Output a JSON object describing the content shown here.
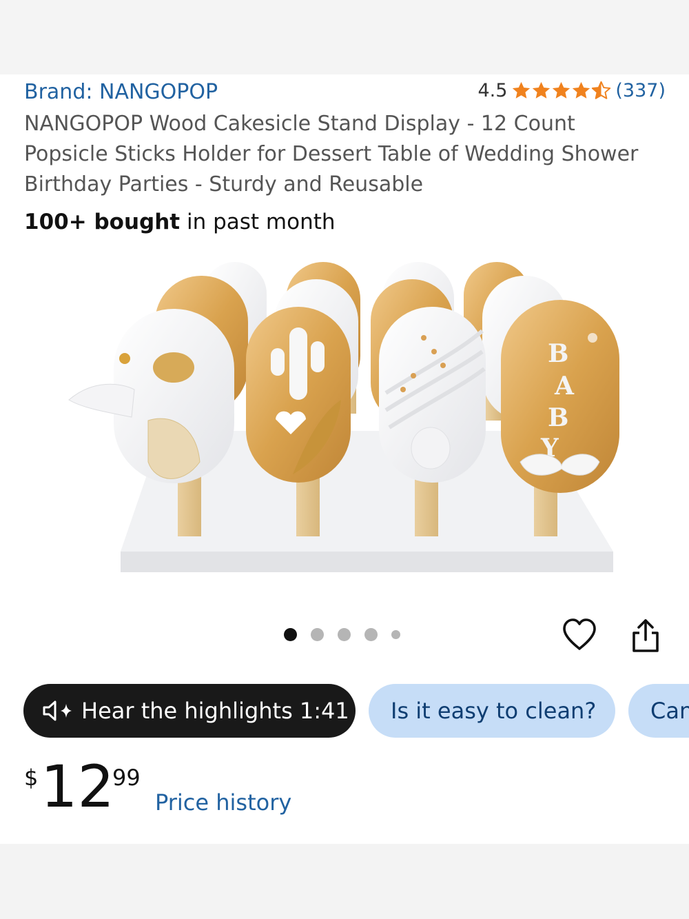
{
  "product": {
    "brand": "Brand: NANGOPOP",
    "rating_value": "4.5",
    "rating": 4.5,
    "rating_count": "(337)",
    "title": "NANGOPOP Wood Cakesicle Stand Display - 12 Count Popsicle Sticks Holder for Dessert Table of Wedding Shower Birthday Parties - Sturdy and Reusable",
    "bought_bold": "100+ bought",
    "bought_rest": " in past month",
    "image_letters": [
      "B",
      "A",
      "B",
      "Y"
    ]
  },
  "gallery": {
    "image_count": 5,
    "active_index": 0
  },
  "actions": {
    "favorite_icon": "heart-icon",
    "share_icon": "share-icon"
  },
  "chips": {
    "hear_label": "Hear the highlights 1:41",
    "hear_icon": "speaker-sparkle-icon",
    "question_1": "Is it easy to clean?",
    "question_2": "Can"
  },
  "price": {
    "symbol": "$",
    "whole": "12",
    "fraction": "99",
    "history_label": "Price history"
  },
  "colors": {
    "link_blue": "#2162a1",
    "star_orange": "#f0821e",
    "chip_dark": "#191919",
    "chip_light_blue": "#c6ddf7"
  }
}
